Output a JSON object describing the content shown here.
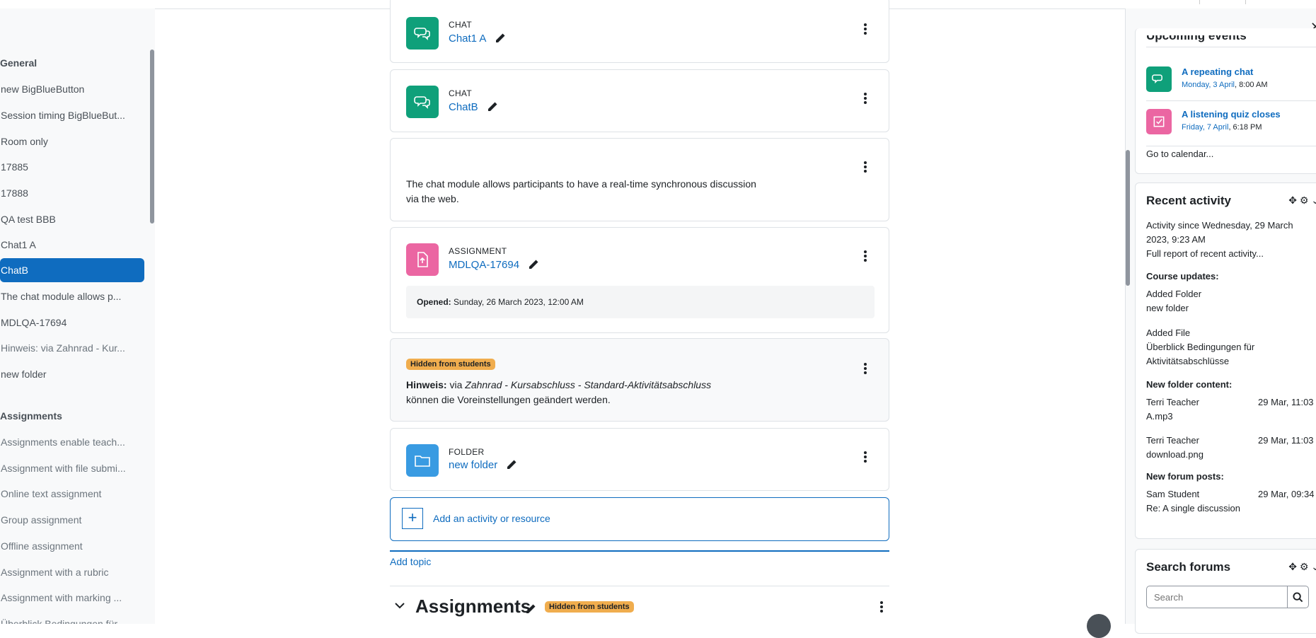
{
  "course_index": {
    "sections": [
      {
        "title": "General",
        "items": [
          {
            "label": "new BigBlueButton"
          },
          {
            "label": "Session timing BigBlueBut..."
          },
          {
            "label": "Room only"
          },
          {
            "label": "17885"
          },
          {
            "label": "17888"
          },
          {
            "label": "QA test BBB"
          },
          {
            "label": "Chat1 A"
          },
          {
            "label": "ChatB",
            "active": true
          },
          {
            "label": "The chat module allows p..."
          },
          {
            "label": "MDLQA-17694"
          },
          {
            "label": "Hinweis: via Zahnrad - Kur..."
          },
          {
            "label": "new folder"
          }
        ]
      },
      {
        "title": "Assignments",
        "items": [
          {
            "label": "Assignments enable teach..."
          },
          {
            "label": "Assignment with file submi..."
          },
          {
            "label": "Online text assignment"
          },
          {
            "label": "Group assignment"
          },
          {
            "label": "Offline assignment"
          },
          {
            "label": "Assignment with a rubric"
          },
          {
            "label": "Assignment with marking ..."
          },
          {
            "label": "Überblick Bedingungen für..."
          }
        ]
      }
    ]
  },
  "main": {
    "chat1": {
      "type": "CHAT",
      "name": "Chat1 A"
    },
    "chatb": {
      "type": "CHAT",
      "name": "ChatB"
    },
    "label_text": "The chat module allows participants to have a real-time synchronous discussion via the web.",
    "assignment": {
      "type": "ASSIGNMENT",
      "name": "MDLQA-17694",
      "opened_label": "Opened:",
      "opened_value": "Sunday, 26 March 2023, 12:00 AM"
    },
    "hinweis": {
      "badge": "Hidden from students",
      "bold": "Hinweis:",
      "text1": "via",
      "italic": "Zahnrad - Kursabschluss - Standard-Aktivitätsabschluss",
      "text2": "können die Voreinstellungen geändert werden."
    },
    "folder": {
      "type": "FOLDER",
      "name": "new folder"
    },
    "add_activity": "Add an activity or resource",
    "add_topic": "Add topic",
    "next_section": {
      "title": "Assignments",
      "badge": "Hidden from students"
    }
  },
  "drawer": {
    "upcoming": {
      "title": "Upcoming events",
      "events": [
        {
          "name": "A repeating chat",
          "date_link": "Monday, 3 April",
          "time": ", 8:00 AM"
        },
        {
          "name": "A listening quiz closes",
          "date_link": "Friday, 7 April",
          "time": ", 6:18 PM"
        }
      ],
      "calendar_link": "Go to calendar..."
    },
    "recent": {
      "title": "Recent activity",
      "since": "Activity since Wednesday, 29 March 2023, 9:23 AM",
      "since_l1": "Activity since Wednesday, 29 March",
      "since_l2": "2023, 9:23 AM",
      "full_report": "Full report of recent activity...",
      "course_updates": "Course updates:",
      "added_folder": "Added Folder",
      "folder_link": "new folder",
      "added_file": "Added File",
      "file_link_l1": "Überblick Bedingungen für",
      "file_link_l2": "Aktivitätsabschlüsse",
      "new_folder_content": "New folder content:",
      "fc": [
        {
          "user": "Terri Teacher",
          "date": "29 Mar, 11:03",
          "file": "A.mp3"
        },
        {
          "user": "Terri Teacher",
          "date": "29 Mar, 11:03",
          "file": "download.png"
        }
      ],
      "new_forum_posts": "New forum posts:",
      "post": {
        "user": "Sam Student",
        "date": "29 Mar, 09:34",
        "link": "Re: A single discussion"
      }
    },
    "search_forums": {
      "title": "Search forums",
      "placeholder": "Search"
    }
  },
  "colors": {
    "accent": "#0f6cbf",
    "chat": "#0fa07a",
    "assignment": "#eb66a2",
    "folder": "#399be2",
    "badge": "#f0ad4e"
  }
}
